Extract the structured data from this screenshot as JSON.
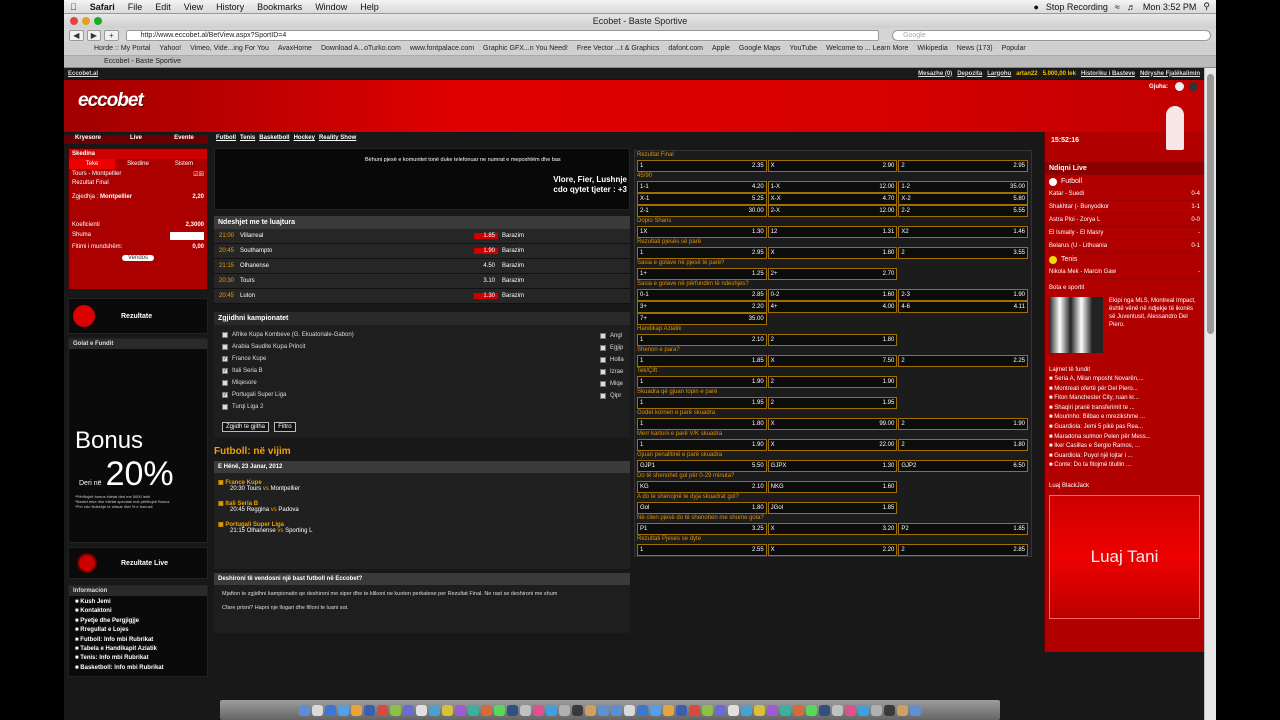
{
  "menubar": {
    "app": "Safari",
    "items": [
      "File",
      "Edit",
      "View",
      "History",
      "Bookmarks",
      "Window",
      "Help"
    ],
    "stop_recording": "Stop Recording",
    "clock": "Mon 3:52 PM"
  },
  "window": {
    "title": "Ecobet - Baste Sportive",
    "url": "http://www.eccobet.al/BetView.aspx?SportID=4",
    "search_placeholder": "Google",
    "tab": "Eccobet - Baste Sportive"
  },
  "bookmarks": [
    "Horde :: My Portal",
    "Yahoo!",
    "Vimeo, Vide...ing For You",
    "AvaxHome",
    "Download A...oTurko.com",
    "www.fontpalace.com",
    "Graphic GFX...n You Need!",
    "Free Vector ...t & Graphics",
    "dafont.com",
    "Apple",
    "Google Maps",
    "YouTube",
    "Welcome to ... Learn More",
    "Wikipedia",
    "News (173)",
    "Popular"
  ],
  "site": {
    "home_link": "Eccobet.al",
    "user_links": [
      "Mesazhe (0)",
      "Depozita",
      "Largohu",
      "artan22",
      "5.000,00 lek",
      "Historiku i Basteve",
      "Ndryshe Fjalëkalimin"
    ],
    "logo": "eccobet",
    "language_label": "Gjuha:",
    "left_tabs": [
      "Kryesore",
      "Live",
      "Evente"
    ],
    "sport_tabs": [
      "Futboll",
      "Tenis",
      "Basketboll",
      "Hockey",
      "Reality Show"
    ],
    "betslip": {
      "title": "Skedina",
      "tabs": [
        "Teke",
        "Skedine",
        "Sistem"
      ],
      "match": "Tours - Montpellier",
      "market": "Rezultat Final",
      "selection_label": "Zgjedhja :",
      "selection": "Montpellier",
      "selection_odd": "2,20",
      "coef_label": "Koeficienti",
      "coef": "2,3000",
      "amount_label": "Shuma",
      "win_label": "Fitimi i mundshëm:",
      "win": "0,00",
      "submit": "Vendos"
    },
    "results_label": "Rezultate",
    "goals_label": "Golat e Fundit",
    "bonus": {
      "title": "Bonus",
      "prefix": "Deri në",
      "value": "20%",
      "fine1": "*Përfitojnë bonus biletat deri me 5000 lekë",
      "fine2": "*Bastet teke dhe biletat speciale nuk përfitojnë Bonus",
      "fine3": "*Per cdo Ndeshje te shtuar ritet % e bonusit"
    },
    "live_results_label": "Rezultate Live",
    "info": {
      "title": "Informacion",
      "items": [
        "Kush Jemi",
        "Kontaktoni",
        "Pyetje dhe Pergjigjje",
        "Rregullat e Lojes",
        "Futboll: Info mbi Rubrikat",
        "Tabela e Handikapit Aziatik",
        "Tenis: Info mbi Rubrikat",
        "Basketboll: Info mbi Rubrikat"
      ]
    },
    "promo": {
      "text": "Bëhuni pjesë e komunitet tonë duke telefonuar ne numrat e meposhtëm dhe bas",
      "line1": "Vlore, Fier, Lushnje",
      "line2": "cdo qytet tjeter : +3"
    },
    "played": {
      "title": "Ndeshjet me te luajtura",
      "rows": [
        {
          "time": "21:00",
          "team": "Villarreal",
          "odd": "1.85",
          "red": true,
          "bet": "Barazim"
        },
        {
          "time": "20:45",
          "team": "Southampto",
          "odd": "1.90",
          "red": true,
          "bet": "Barazim"
        },
        {
          "time": "21:15",
          "team": "Olhanense",
          "odd": "4.50",
          "red": false,
          "bet": "Barazim"
        },
        {
          "time": "20:30",
          "team": "Tours",
          "odd": "3.10",
          "red": false,
          "bet": "Barazim"
        },
        {
          "time": "20:45",
          "team": "Luton",
          "odd": "1.30",
          "red": true,
          "bet": "Barazim"
        }
      ]
    },
    "champs": {
      "title": "Zgjidhni kampionatet",
      "items": [
        {
          "label": "Afrike Kupa Kombeve (G. Ekuatoriale-Gabon)",
          "checked": false
        },
        {
          "label": "Arabia Saudite Kupa Princit",
          "checked": false
        },
        {
          "label": "France Kupe",
          "checked": true
        },
        {
          "label": "Itali Seria B",
          "checked": true
        },
        {
          "label": "Miqesore",
          "checked": false
        },
        {
          "label": "Portugali Super Liga",
          "checked": true
        },
        {
          "label": "Turqi Liga 2",
          "checked": false
        }
      ],
      "right_items": [
        "Angl",
        "Egjip",
        "Holla",
        "Izrae",
        "Miqe",
        "Qipr"
      ],
      "select_all": "Zgjidh te gjitha",
      "filter": "Filtro"
    },
    "upcoming": {
      "title": "Futboll: në vijim",
      "date": "E Hënë, 23 Janar, 2012",
      "groups": [
        {
          "league": "France Kupe",
          "time": "20:30",
          "home": "Tours",
          "vs": "vs",
          "away": "Montpellier"
        },
        {
          "league": "Itali Seria B",
          "time": "20:45",
          "home": "Reggina",
          "vs": "vs",
          "away": "Padova"
        },
        {
          "league": "Portugali Super Liga",
          "time": "21:15",
          "home": "Olhanense",
          "vs": "vs",
          "away": "Sporting L"
        }
      ]
    },
    "faq": {
      "title": "Deshironi të vendosni një bast futboll në Eccobet?",
      "p1": "Mjafton te zgjidhni kampionatin qe deshironi me siper dhe te klikoni ne kuoten perkatese per Rezultat Final. Ne rast se deshironi me shum",
      "p2": "Cfare prisni? Hapni nje llogari dhe filloni te luani sot."
    },
    "markets": [
      {
        "name": "Rezultat Final",
        "rows": [
          [
            [
              "1",
              "2.35"
            ],
            [
              "X",
              "2.90"
            ],
            [
              "2",
              "2.95"
            ]
          ]
        ]
      },
      {
        "name": "45/90",
        "rows": [
          [
            [
              "1-1",
              "4.20"
            ],
            [
              "1-X",
              "12.00"
            ],
            [
              "1-2",
              "35.00"
            ]
          ],
          [
            [
              "X-1",
              "5.25"
            ],
            [
              "X-X",
              "4.70"
            ],
            [
              "X-2",
              "5.80"
            ]
          ],
          [
            [
              "2-1",
              "30.00"
            ],
            [
              "2-X",
              "12.00"
            ],
            [
              "2-2",
              "5.55"
            ]
          ]
        ]
      },
      {
        "name": "Dopio Shans",
        "rows": [
          [
            [
              "1X",
              "1.30"
            ],
            [
              "12",
              "1.31"
            ],
            [
              "X2",
              "1.46"
            ]
          ]
        ]
      },
      {
        "name": "Rezultati pjesës së parë",
        "rows": [
          [
            [
              "1",
              "2.95"
            ],
            [
              "X",
              "1.80"
            ],
            [
              "2",
              "3.55"
            ]
          ]
        ]
      },
      {
        "name": "Sasia e golave në pjesë të parë?",
        "rows": [
          [
            [
              "1+",
              "1.25"
            ],
            [
              "2+",
              "2.70"
            ]
          ]
        ]
      },
      {
        "name": "Sasia e golave në përfundim të ndeshjes?",
        "rows": [
          [
            [
              "0-1",
              "2.85"
            ],
            [
              "0-2",
              "1.60"
            ],
            [
              "2-3",
              "1.90"
            ]
          ],
          [
            [
              "3+",
              "2.20"
            ],
            [
              "4+",
              "4.00"
            ],
            [
              "4-6",
              "4.11"
            ]
          ],
          [
            [
              "7+",
              "35.00"
            ]
          ]
        ]
      },
      {
        "name": "Handikap Aziatik",
        "rows": [
          [
            [
              "1",
              "2.10"
            ],
            [
              "2",
              "1.80"
            ]
          ]
        ]
      },
      {
        "name": "Shenon e para?",
        "rows": [
          [
            [
              "1",
              "1.85"
            ],
            [
              "X",
              "7.50"
            ],
            [
              "2",
              "2.25"
            ]
          ]
        ]
      },
      {
        "name": "Tek/Çift",
        "rows": [
          [
            [
              "1",
              "1.90"
            ],
            [
              "2",
              "1.90"
            ]
          ]
        ]
      },
      {
        "name": "Skuadra që gjuan topin e parë",
        "rows": [
          [
            [
              "1",
              "1.95"
            ],
            [
              "2",
              "1.95"
            ]
          ]
        ]
      },
      {
        "name": "Godet kornen e parë skuadra",
        "rows": [
          [
            [
              "1",
              "1.80"
            ],
            [
              "X",
              "99.00"
            ],
            [
              "2",
              "1.90"
            ]
          ]
        ]
      },
      {
        "name": "Merr kartoni e parë V/K skuadra",
        "rows": [
          [
            [
              "1",
              "1.90"
            ],
            [
              "X",
              "22.00"
            ],
            [
              "2",
              "1.80"
            ]
          ]
        ]
      },
      {
        "name": "Gjuan penalltinë e parë skuadra",
        "rows": [
          [
            [
              "GJP1",
              "5.50"
            ],
            [
              "GJPX",
              "1.30"
            ],
            [
              "GJP2",
              "6.50"
            ]
          ]
        ]
      },
      {
        "name": "Do të shenohet gol për 0-29 minuta?",
        "rows": [
          [
            [
              "KG",
              "2.10"
            ],
            [
              "NKG",
              "1.60"
            ]
          ]
        ]
      },
      {
        "name": "A do te shenojnë te dyja skuadrat gol?",
        "rows": [
          [
            [
              "Gol",
              "1.80"
            ],
            [
              "JGol",
              "1.85"
            ]
          ]
        ]
      },
      {
        "name": "Në cilen pjesë do të shenohen me shume gola?",
        "rows": [
          [
            [
              "P1",
              "3.25"
            ],
            [
              "X",
              "3.20"
            ],
            [
              "P2",
              "1.85"
            ]
          ]
        ]
      },
      {
        "name": "Rezultati Pjeses se dyte",
        "rows": [
          [
            [
              "1",
              "2.55"
            ],
            [
              "X",
              "2.20"
            ],
            [
              "2",
              "2.85"
            ]
          ]
        ]
      }
    ],
    "sidebar": {
      "time": "15:52:16",
      "live_title": "Ndiqni Live",
      "football": "Futboll",
      "live": [
        {
          "match": "Katar - Suedi",
          "score": "0-4"
        },
        {
          "match": "Shakhtar (- Bunyodkor",
          "score": "1-1"
        },
        {
          "match": "Astra Ploi - Zorya L",
          "score": "0-0"
        },
        {
          "match": "El Ismaily - El Masry",
          "score": "-"
        },
        {
          "match": "Belarus (U - Lithuania",
          "score": "0-1"
        }
      ],
      "tennis": "Tenis",
      "tennis_match": "Nikola Mek - Marcin Gaw",
      "tennis_score": "-",
      "world_title": "Bota e sportit",
      "world_text": "Ekipi nga MLS, Montreal Impact, është vënë në ndjekje të ikonës së Juventusit, Alessandro Del Piero.",
      "news_title": "Lajmet të fundit",
      "news": [
        "Seria A, Milan mposht Novarën,...",
        "Montreali ofertë për Del Piero...",
        "Fiton Manchester City, ruan kr...",
        "Shaqiri pranë transferimit te ...",
        "Mourinho: Bilbao e mrezikshme ...",
        "Guardiola: Jemi 5 pikë pas Rea...",
        "Maradona sulmon Pelen për Mess...",
        "Iker Casillas e Sergio Ramos, ...",
        "Guardiola: Puyol një lojtar i ...",
        "Conte: Do ta fitojmë titullin ..."
      ],
      "blackjack_title": "Luaj BlackJack",
      "blackjack_cta": "Luaj Tani"
    }
  }
}
